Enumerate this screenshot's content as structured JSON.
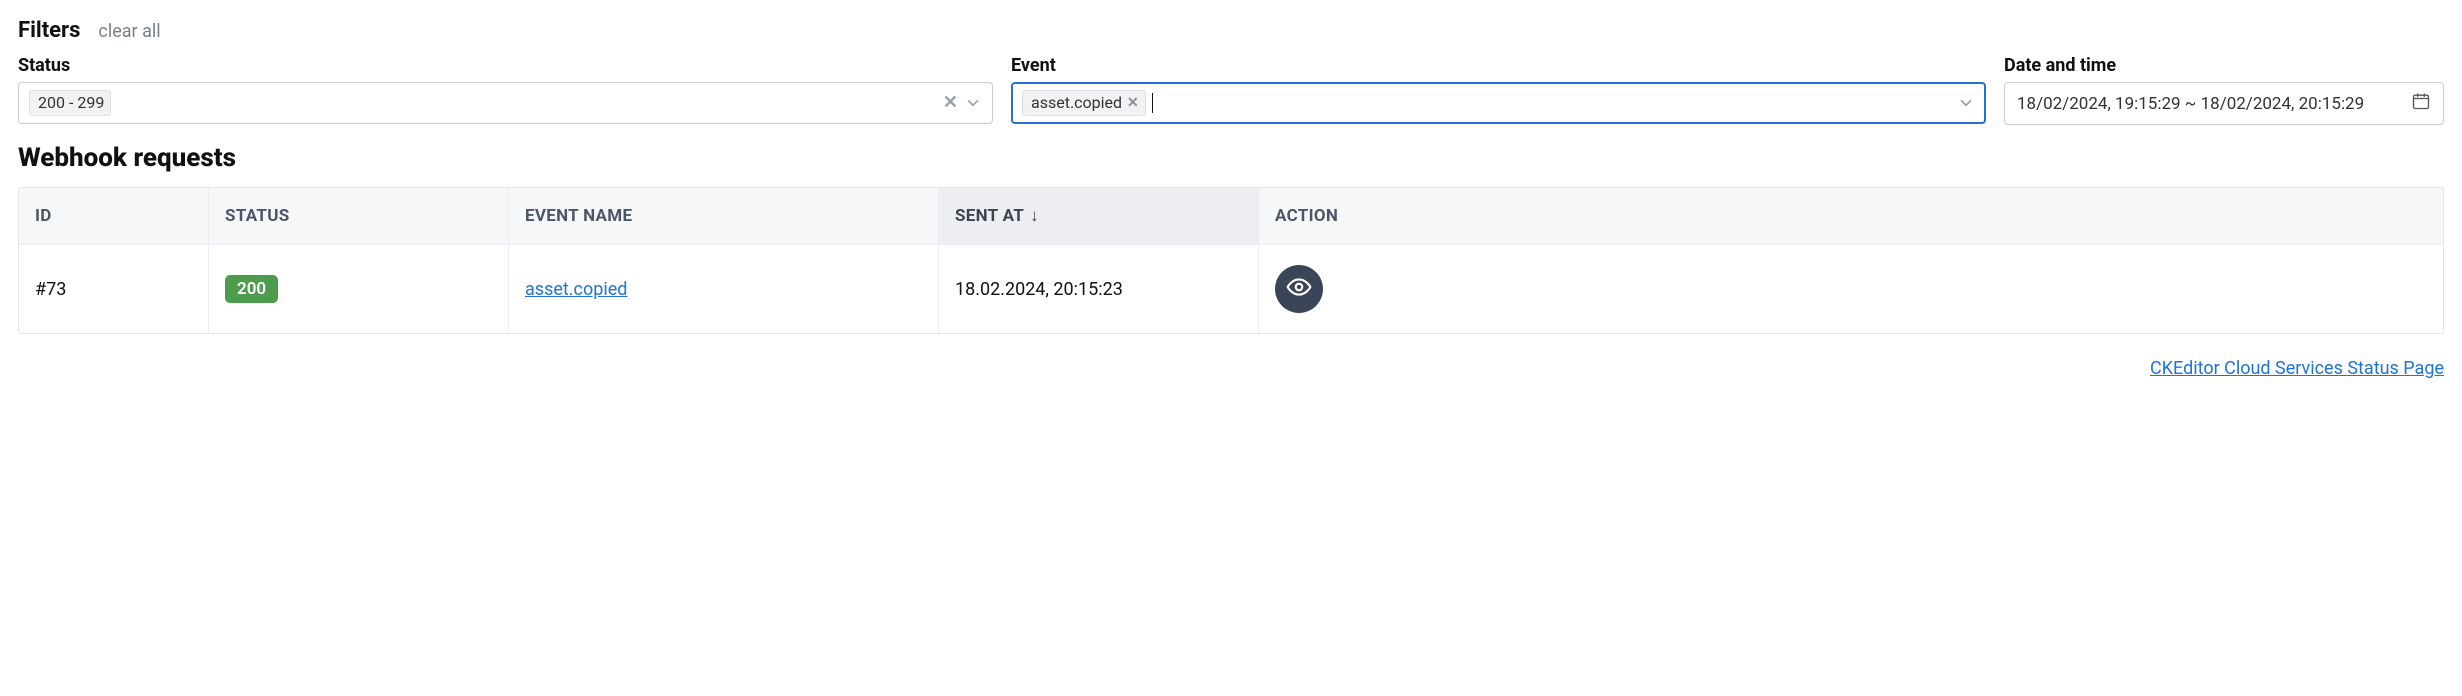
{
  "filters": {
    "title": "Filters",
    "clear_all": "clear all",
    "status_label": "Status",
    "status_tag": "200 - 299",
    "event_label": "Event",
    "event_tag": "asset.copied",
    "date_label": "Date and time",
    "date_value": "18/02/2024, 19:15:29 ~ 18/02/2024, 20:15:29"
  },
  "section_title": "Webhook requests",
  "columns": {
    "id": "ID",
    "status": "STATUS",
    "event": "EVENT NAME",
    "sent": "SENT AT",
    "action": "ACTION"
  },
  "sort_indicator": "↓",
  "row": {
    "id": "#73",
    "status": "200",
    "event": "asset.copied",
    "sent": "18.02.2024, 20:15:23"
  },
  "footer_link": "CKEditor Cloud Services Status Page"
}
